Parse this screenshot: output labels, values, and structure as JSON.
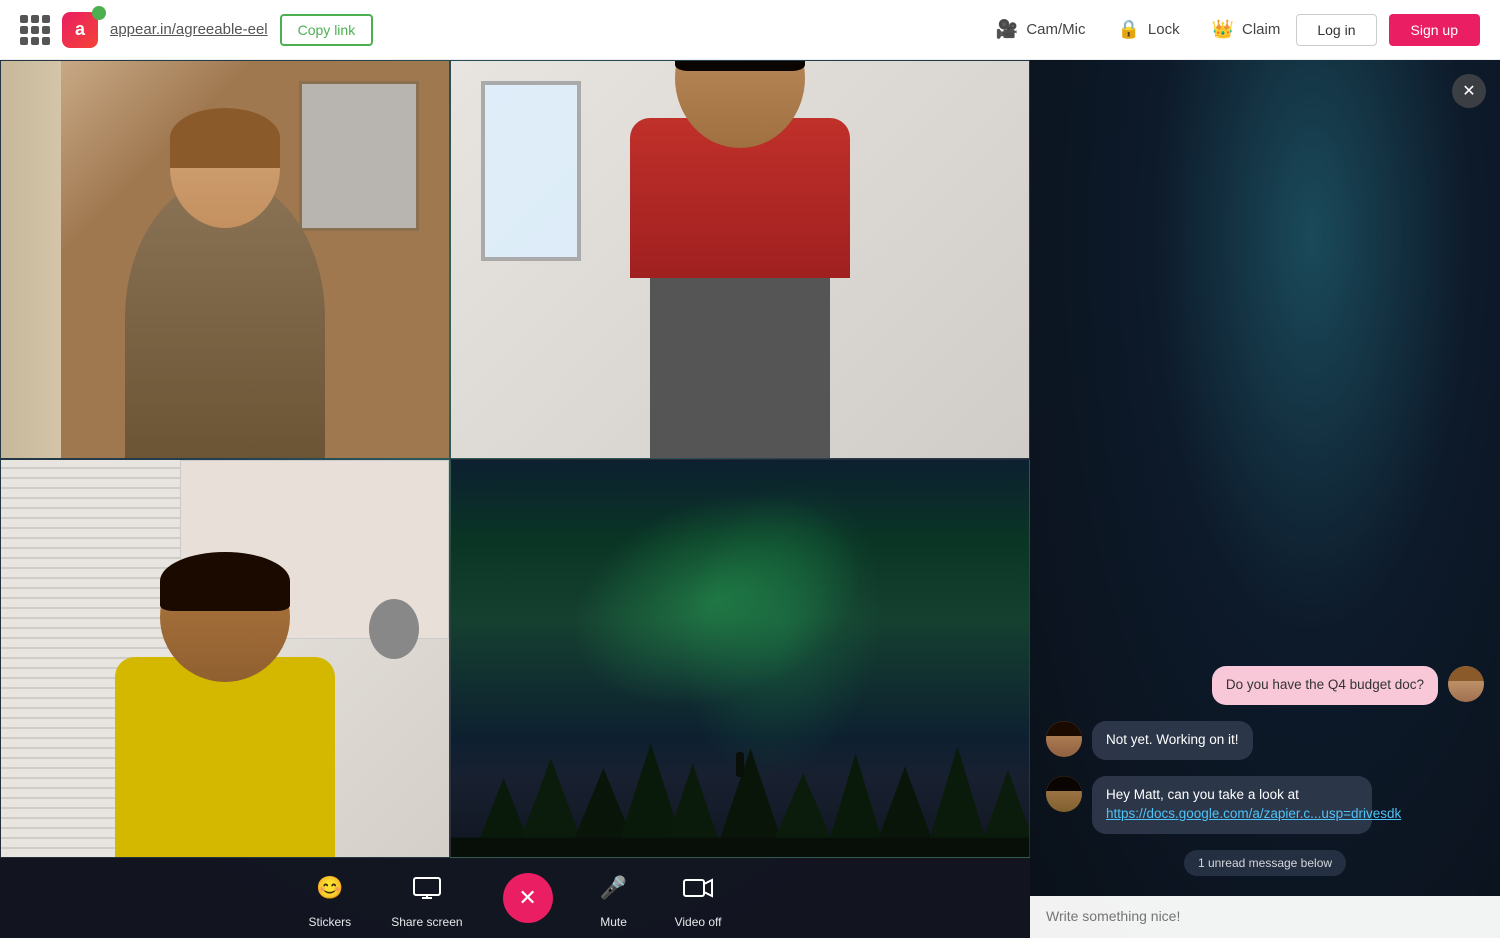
{
  "nav": {
    "grid_icon": "grid",
    "logo_letter": "a",
    "url": "appear.in/agreeable-eel",
    "copy_link": "Copy link",
    "cam_mic": "Cam/Mic",
    "lock": "Lock",
    "claim": "Claim",
    "login": "Log in",
    "signup": "Sign up"
  },
  "toolbar": {
    "stickers": "Stickers",
    "share_screen": "Share screen",
    "mute": "Mute",
    "video_off": "Video off"
  },
  "chat": {
    "close_label": "×",
    "messages": [
      {
        "id": "msg1",
        "type": "self",
        "text": "Do you have the Q4 budget doc?"
      },
      {
        "id": "msg2",
        "type": "other",
        "text": "Not yet. Working on it!"
      },
      {
        "id": "msg3",
        "type": "other",
        "text": "Hey Matt, can you take a look at https://docs.google.com/a/zapier.c...usp=drivesdk"
      }
    ],
    "unread_banner": "1 unread message below",
    "input_placeholder": "Write something nice!"
  }
}
